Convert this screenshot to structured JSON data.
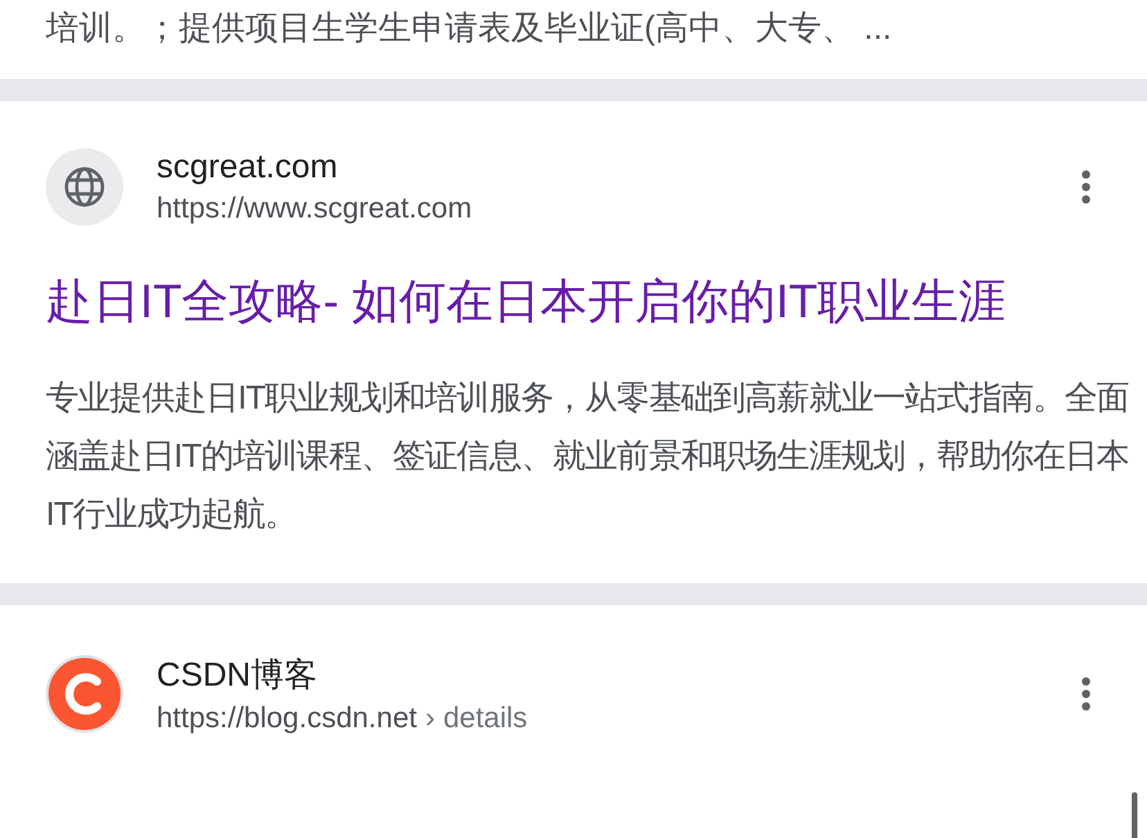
{
  "previous_snippet": "培训。；提供项目生学生申请表及毕业证(高中、大专、 ...",
  "results": [
    {
      "kind": "globe",
      "site": "scgreat.com",
      "url": "https://www.scgreat.com",
      "title": "赴日IT全攻略- 如何在日本开启你的IT职业生涯",
      "snippet": "专业提供赴日IT职业规划和培训服务，从零基础到高薪就业一站式指南。全面涵盖赴日IT的培训课程、签证信息、就业前景和职场生涯规划，帮助你在日本IT行业成功起航。"
    },
    {
      "kind": "c-logo",
      "site": "CSDN博客",
      "url": "https://blog.csdn.net",
      "separator": "›",
      "path": "details"
    }
  ]
}
